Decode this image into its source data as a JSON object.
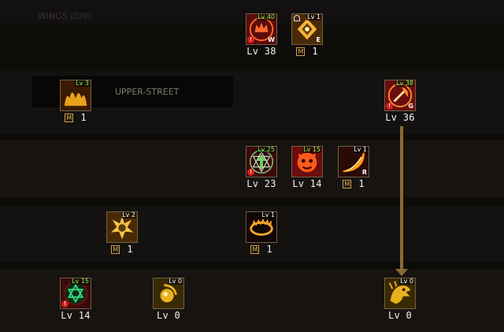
{
  "background_text": {
    "top_left": "WINGS (0/0)",
    "mid_tooltip": "UPPER-STREET"
  },
  "skills": [
    {
      "id": "crown",
      "badge": "Lv 40",
      "badge_color": "green",
      "corner": "W",
      "warn": true,
      "lock": false,
      "footer": "level",
      "label": "Lv 38",
      "icon": "crown-icon",
      "bg": "#5a0b0b",
      "fg": "#ff6a2a"
    },
    {
      "id": "diamond",
      "badge": "Lv 1",
      "badge_color": "white",
      "corner": "E",
      "warn": false,
      "lock": true,
      "footer": "mastery",
      "label": "1",
      "icon": "diamond-rune-icon",
      "bg": "#4a2a06",
      "fg": "#f3b43b"
    },
    {
      "id": "flames",
      "badge": "Lv 3",
      "badge_color": "green",
      "corner": "",
      "warn": false,
      "lock": false,
      "footer": "mastery",
      "label": "1",
      "icon": "flame-wave-icon",
      "bg": "#3a1a04",
      "fg": "#e9a11c"
    },
    {
      "id": "axe",
      "badge": "Lv 38",
      "badge_color": "green",
      "corner": "G",
      "warn": true,
      "lock": false,
      "footer": "level",
      "label": "Lv 36",
      "icon": "axe-icon",
      "bg": "#6a0d0d",
      "fg": "#ff8a2a"
    },
    {
      "id": "star",
      "badge": "Lv 25",
      "badge_color": "green",
      "corner": "",
      "warn": true,
      "lock": false,
      "footer": "level",
      "label": "Lv 23",
      "icon": "star-arrow-icon",
      "bg": "#3a0a0a",
      "fg": "#6ad66a"
    },
    {
      "id": "demon",
      "badge": "Lv 15",
      "badge_color": "green",
      "corner": "",
      "warn": false,
      "lock": false,
      "footer": "level",
      "label": "Lv 14",
      "icon": "demon-face-icon",
      "bg": "#6a0d0d",
      "fg": "#ff5a1a"
    },
    {
      "id": "slash",
      "badge": "Lv 1",
      "badge_color": "white",
      "corner": "R",
      "warn": false,
      "lock": false,
      "footer": "mastery",
      "label": "1",
      "icon": "fire-slash-icon",
      "bg": "#2a0a04",
      "fg": "#ff9a1a"
    },
    {
      "id": "spikes",
      "badge": "Lv 2",
      "badge_color": "white",
      "corner": "",
      "warn": false,
      "lock": false,
      "footer": "mastery",
      "label": "1",
      "icon": "spike-burst-icon",
      "bg": "#4a2a06",
      "fg": "#f3c34b"
    },
    {
      "id": "ring",
      "badge": "Lv 1",
      "badge_color": "white",
      "corner": "",
      "warn": false,
      "lock": false,
      "footer": "mastery",
      "label": "1",
      "icon": "fire-ring-icon",
      "bg": "#120606",
      "fg": "#f3a52b"
    },
    {
      "id": "hexagram",
      "badge": "Lv 15",
      "badge_color": "green",
      "corner": "",
      "warn": true,
      "lock": false,
      "footer": "level",
      "label": "Lv 14",
      "icon": "hexagram-icon",
      "bg": "#3a0a0a",
      "fg": "#3ad67a"
    },
    {
      "id": "orb",
      "badge": "Lv 0",
      "badge_color": "white",
      "corner": "",
      "warn": false,
      "lock": false,
      "footer": "level",
      "label": "Lv 0",
      "icon": "orb-slash-icon",
      "bg": "#3a2a04",
      "fg": "#e8b21c"
    },
    {
      "id": "dragon",
      "badge": "Lv 0",
      "badge_color": "white",
      "corner": "",
      "warn": false,
      "lock": false,
      "footer": "level",
      "label": "Lv 0",
      "icon": "dragon-head-icon",
      "bg": "#3a2a04",
      "fg": "#e8b21c"
    }
  ],
  "mastery_mark": "M",
  "warn_mark": "!"
}
